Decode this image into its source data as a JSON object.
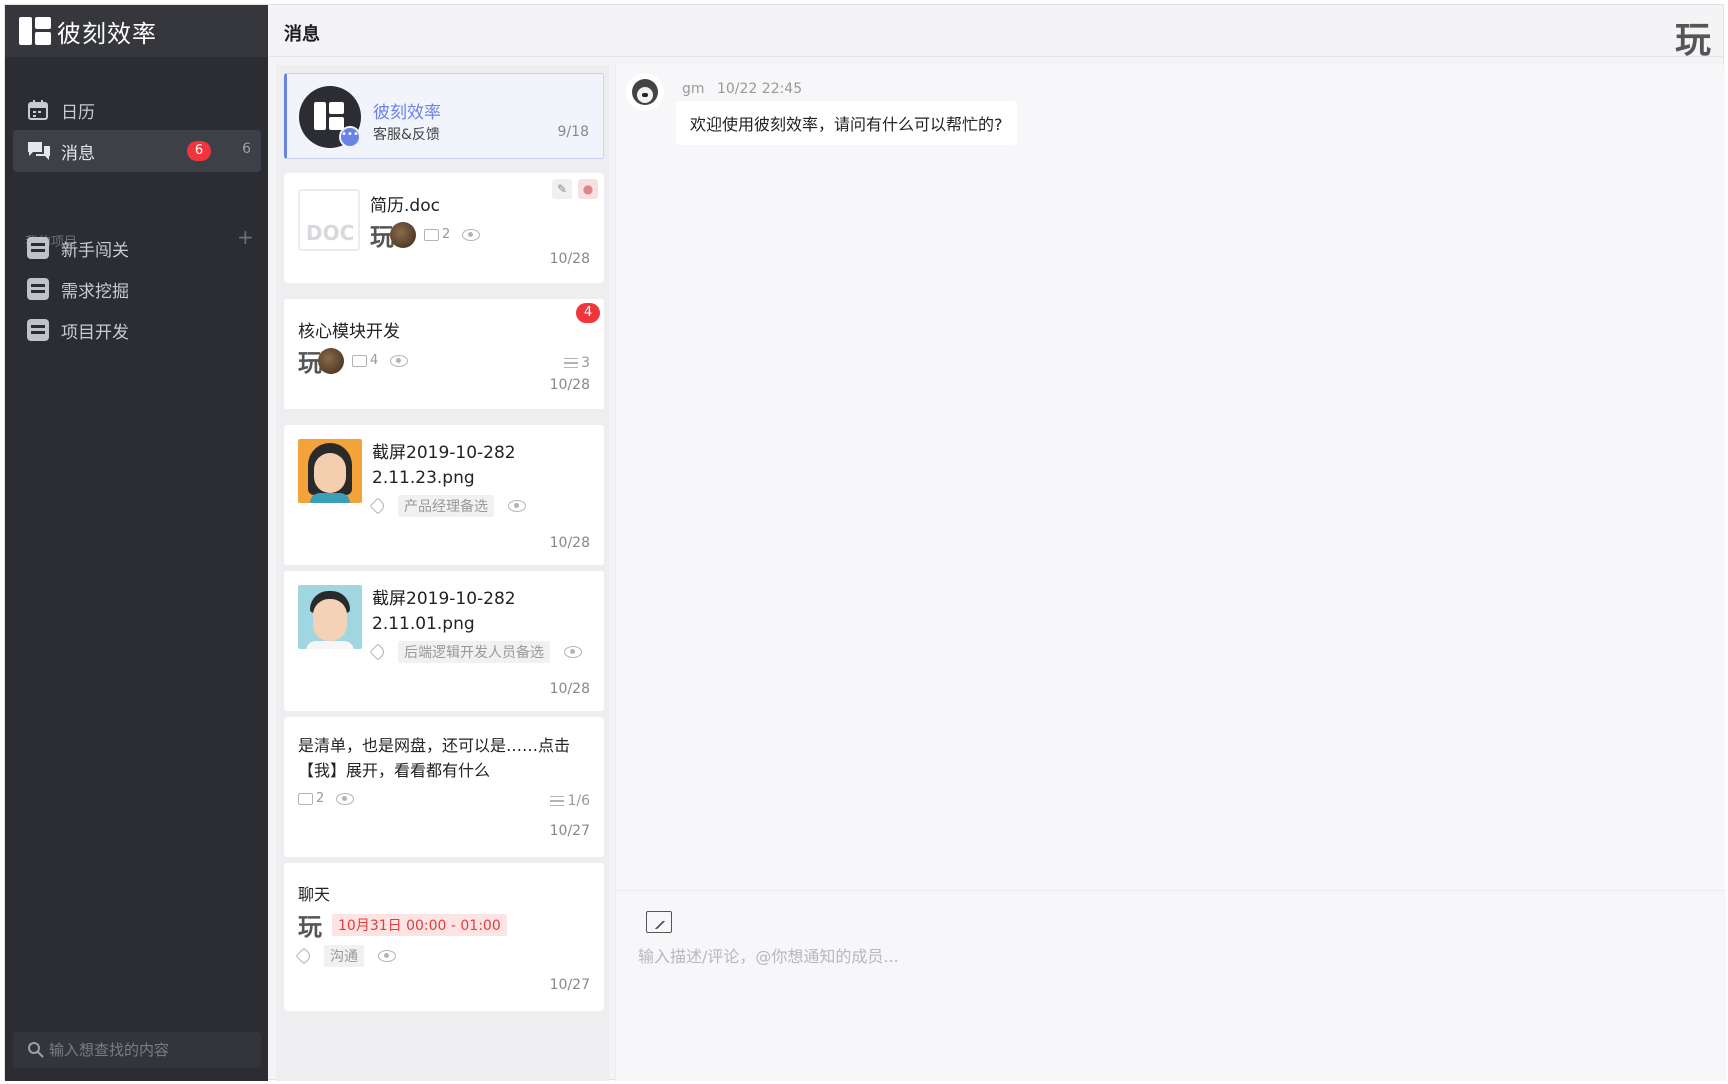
{
  "brand": {
    "name": "彼刻效率"
  },
  "header": {
    "title": "消息"
  },
  "sidebar": {
    "nav": [
      {
        "label": "日历"
      },
      {
        "label": "消息",
        "badge": "6",
        "count": "6"
      }
    ],
    "section_title": "我的项目",
    "section_add": "+",
    "projects": [
      {
        "label": "新手闯关"
      },
      {
        "label": "需求挖掘"
      },
      {
        "label": "项目开发"
      }
    ],
    "search": {
      "placeholder": "输入想查找的内容"
    }
  },
  "messages": [
    {
      "title": "彼刻效率",
      "subtitle": "客服&反馈",
      "date": "9/18"
    },
    {
      "title": "简历.doc",
      "file_label": "DOC",
      "comments": "2",
      "date": "10/28"
    },
    {
      "title": "核心模块开发",
      "comments": "4",
      "badge": "4",
      "subtasks": "3",
      "date": "10/28"
    },
    {
      "title": "截屏2019-10-2822.11.23.png",
      "tag": "产品经理备选",
      "date": "10/28"
    },
    {
      "title": "截屏2019-10-2822.11.01.png",
      "tag": "后端逻辑开发人员备选",
      "date": "10/28"
    },
    {
      "title": "是清单，也是网盘，还可以是……点击【我】展开，看看都有什么",
      "comments": "2",
      "subtasks": "1/6",
      "date": "10/27"
    },
    {
      "title": "聊天",
      "time_range": "10月31日 00:00 - 01:00",
      "tag": "沟通",
      "date": "10/27"
    }
  ],
  "chat": {
    "sender": "gm",
    "timestamp": "10/22 22:45",
    "message": "欢迎使用彼刻效率，请问有什么可以帮忙的?",
    "input_placeholder": "输入描述/评论，@你想通知的成员..."
  },
  "logo_glyph": "玩",
  "colors": {
    "sidebar_bg": "#2b2d33",
    "accent": "#6a84e6",
    "badge_red": "#f0353d"
  }
}
